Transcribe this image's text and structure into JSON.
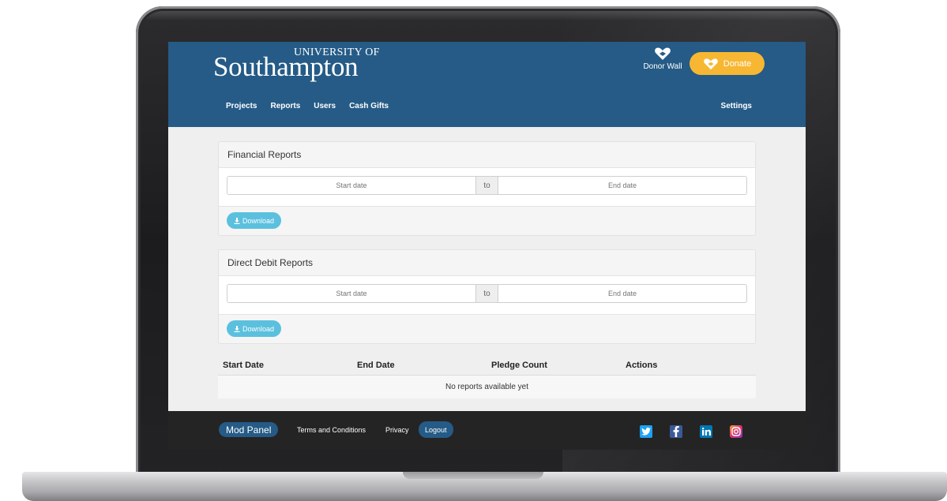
{
  "header": {
    "logo_top": "UNIVERSITY OF",
    "logo_main": "Southampton",
    "donor_wall_label": "Donor Wall",
    "donate_label": "Donate"
  },
  "nav": {
    "items": [
      {
        "label": "Projects"
      },
      {
        "label": "Reports"
      },
      {
        "label": "Users"
      },
      {
        "label": "Cash Gifts"
      }
    ],
    "settings_label": "Settings"
  },
  "financial_reports": {
    "title": "Financial Reports",
    "start_placeholder": "Start date",
    "separator": "to",
    "end_placeholder": "End date",
    "download_label": "Download"
  },
  "direct_debit_reports": {
    "title": "Direct Debit Reports",
    "start_placeholder": "Start date",
    "separator": "to",
    "end_placeholder": "End date",
    "download_label": "Download"
  },
  "reports_table": {
    "columns": [
      "Start Date",
      "End Date",
      "Pledge Count",
      "Actions"
    ],
    "empty_message": "No reports available yet"
  },
  "footer": {
    "mod_panel_label": "Mod Panel",
    "terms_label": "Terms and Conditions",
    "privacy_label": "Privacy",
    "logout_label": "Logout",
    "social": [
      "twitter-icon",
      "facebook-icon",
      "linkedin-icon",
      "instagram-icon"
    ]
  },
  "colors": {
    "brand_blue": "#255b86",
    "donate_yellow": "#f7b733",
    "download_blue": "#5bc0de",
    "footer_bg": "#242424"
  }
}
